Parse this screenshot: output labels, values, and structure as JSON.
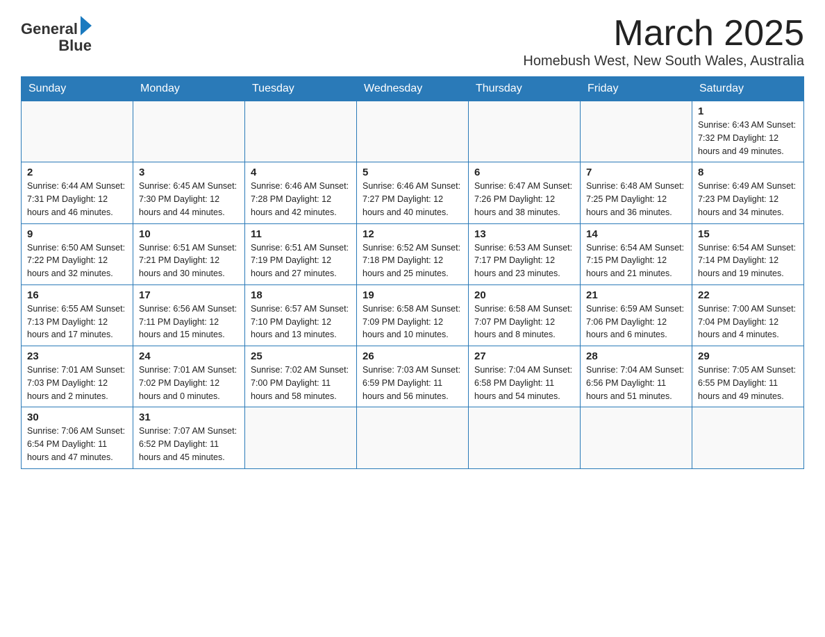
{
  "header": {
    "logo_line1": "General",
    "logo_line2": "Blue",
    "month_year": "March 2025",
    "location": "Homebush West, New South Wales, Australia"
  },
  "days_of_week": [
    "Sunday",
    "Monday",
    "Tuesday",
    "Wednesday",
    "Thursday",
    "Friday",
    "Saturday"
  ],
  "weeks": [
    [
      {
        "day": "",
        "info": ""
      },
      {
        "day": "",
        "info": ""
      },
      {
        "day": "",
        "info": ""
      },
      {
        "day": "",
        "info": ""
      },
      {
        "day": "",
        "info": ""
      },
      {
        "day": "",
        "info": ""
      },
      {
        "day": "1",
        "info": "Sunrise: 6:43 AM\nSunset: 7:32 PM\nDaylight: 12 hours and 49 minutes."
      }
    ],
    [
      {
        "day": "2",
        "info": "Sunrise: 6:44 AM\nSunset: 7:31 PM\nDaylight: 12 hours and 46 minutes."
      },
      {
        "day": "3",
        "info": "Sunrise: 6:45 AM\nSunset: 7:30 PM\nDaylight: 12 hours and 44 minutes."
      },
      {
        "day": "4",
        "info": "Sunrise: 6:46 AM\nSunset: 7:28 PM\nDaylight: 12 hours and 42 minutes."
      },
      {
        "day": "5",
        "info": "Sunrise: 6:46 AM\nSunset: 7:27 PM\nDaylight: 12 hours and 40 minutes."
      },
      {
        "day": "6",
        "info": "Sunrise: 6:47 AM\nSunset: 7:26 PM\nDaylight: 12 hours and 38 minutes."
      },
      {
        "day": "7",
        "info": "Sunrise: 6:48 AM\nSunset: 7:25 PM\nDaylight: 12 hours and 36 minutes."
      },
      {
        "day": "8",
        "info": "Sunrise: 6:49 AM\nSunset: 7:23 PM\nDaylight: 12 hours and 34 minutes."
      }
    ],
    [
      {
        "day": "9",
        "info": "Sunrise: 6:50 AM\nSunset: 7:22 PM\nDaylight: 12 hours and 32 minutes."
      },
      {
        "day": "10",
        "info": "Sunrise: 6:51 AM\nSunset: 7:21 PM\nDaylight: 12 hours and 30 minutes."
      },
      {
        "day": "11",
        "info": "Sunrise: 6:51 AM\nSunset: 7:19 PM\nDaylight: 12 hours and 27 minutes."
      },
      {
        "day": "12",
        "info": "Sunrise: 6:52 AM\nSunset: 7:18 PM\nDaylight: 12 hours and 25 minutes."
      },
      {
        "day": "13",
        "info": "Sunrise: 6:53 AM\nSunset: 7:17 PM\nDaylight: 12 hours and 23 minutes."
      },
      {
        "day": "14",
        "info": "Sunrise: 6:54 AM\nSunset: 7:15 PM\nDaylight: 12 hours and 21 minutes."
      },
      {
        "day": "15",
        "info": "Sunrise: 6:54 AM\nSunset: 7:14 PM\nDaylight: 12 hours and 19 minutes."
      }
    ],
    [
      {
        "day": "16",
        "info": "Sunrise: 6:55 AM\nSunset: 7:13 PM\nDaylight: 12 hours and 17 minutes."
      },
      {
        "day": "17",
        "info": "Sunrise: 6:56 AM\nSunset: 7:11 PM\nDaylight: 12 hours and 15 minutes."
      },
      {
        "day": "18",
        "info": "Sunrise: 6:57 AM\nSunset: 7:10 PM\nDaylight: 12 hours and 13 minutes."
      },
      {
        "day": "19",
        "info": "Sunrise: 6:58 AM\nSunset: 7:09 PM\nDaylight: 12 hours and 10 minutes."
      },
      {
        "day": "20",
        "info": "Sunrise: 6:58 AM\nSunset: 7:07 PM\nDaylight: 12 hours and 8 minutes."
      },
      {
        "day": "21",
        "info": "Sunrise: 6:59 AM\nSunset: 7:06 PM\nDaylight: 12 hours and 6 minutes."
      },
      {
        "day": "22",
        "info": "Sunrise: 7:00 AM\nSunset: 7:04 PM\nDaylight: 12 hours and 4 minutes."
      }
    ],
    [
      {
        "day": "23",
        "info": "Sunrise: 7:01 AM\nSunset: 7:03 PM\nDaylight: 12 hours and 2 minutes."
      },
      {
        "day": "24",
        "info": "Sunrise: 7:01 AM\nSunset: 7:02 PM\nDaylight: 12 hours and 0 minutes."
      },
      {
        "day": "25",
        "info": "Sunrise: 7:02 AM\nSunset: 7:00 PM\nDaylight: 11 hours and 58 minutes."
      },
      {
        "day": "26",
        "info": "Sunrise: 7:03 AM\nSunset: 6:59 PM\nDaylight: 11 hours and 56 minutes."
      },
      {
        "day": "27",
        "info": "Sunrise: 7:04 AM\nSunset: 6:58 PM\nDaylight: 11 hours and 54 minutes."
      },
      {
        "day": "28",
        "info": "Sunrise: 7:04 AM\nSunset: 6:56 PM\nDaylight: 11 hours and 51 minutes."
      },
      {
        "day": "29",
        "info": "Sunrise: 7:05 AM\nSunset: 6:55 PM\nDaylight: 11 hours and 49 minutes."
      }
    ],
    [
      {
        "day": "30",
        "info": "Sunrise: 7:06 AM\nSunset: 6:54 PM\nDaylight: 11 hours and 47 minutes."
      },
      {
        "day": "31",
        "info": "Sunrise: 7:07 AM\nSunset: 6:52 PM\nDaylight: 11 hours and 45 minutes."
      },
      {
        "day": "",
        "info": ""
      },
      {
        "day": "",
        "info": ""
      },
      {
        "day": "",
        "info": ""
      },
      {
        "day": "",
        "info": ""
      },
      {
        "day": "",
        "info": ""
      }
    ]
  ]
}
